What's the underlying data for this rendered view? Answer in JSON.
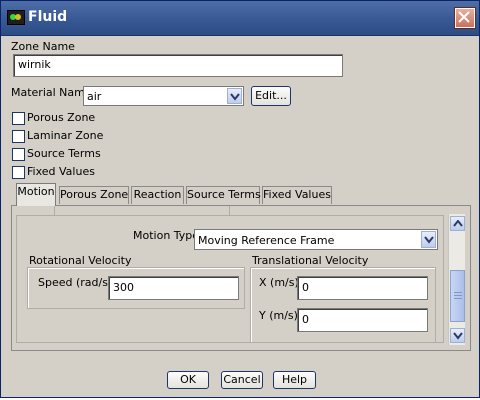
{
  "window": {
    "title": "Fluid",
    "icon": "fluent-app-icon",
    "close": "close-icon"
  },
  "zone": {
    "label": "Zone Name",
    "value": "wirnik"
  },
  "material": {
    "label": "Material Name",
    "value": "air",
    "edit_label": "Edit..."
  },
  "options": [
    {
      "label": "Porous Zone",
      "checked": false
    },
    {
      "label": "Laminar Zone",
      "checked": false
    },
    {
      "label": "Source Terms",
      "checked": false
    },
    {
      "label": "Fixed Values",
      "checked": false
    }
  ],
  "tabs": [
    {
      "label": "Motion",
      "active": true
    },
    {
      "label": "Porous Zone",
      "active": false
    },
    {
      "label": "Reaction",
      "active": false
    },
    {
      "label": "Source Terms",
      "active": false
    },
    {
      "label": "Fixed Values",
      "active": false
    }
  ],
  "motion": {
    "type_label": "Motion Type",
    "type_value": "Moving Reference Frame",
    "rotational": {
      "title": "Rotational Velocity",
      "speed_label": "Speed (rad/s)",
      "speed_value": "300"
    },
    "translational": {
      "title": "Translational Velocity",
      "x_label": "X (m/s)",
      "x_value": "0",
      "y_label": "Y (m/s)",
      "y_value": "0"
    }
  },
  "footer": {
    "ok": "OK",
    "cancel": "Cancel",
    "help": "Help"
  },
  "colors": {
    "title_bar": "#3a5a97",
    "dialog_bg": "#d4d0c8",
    "button_border": "#1c3569"
  }
}
